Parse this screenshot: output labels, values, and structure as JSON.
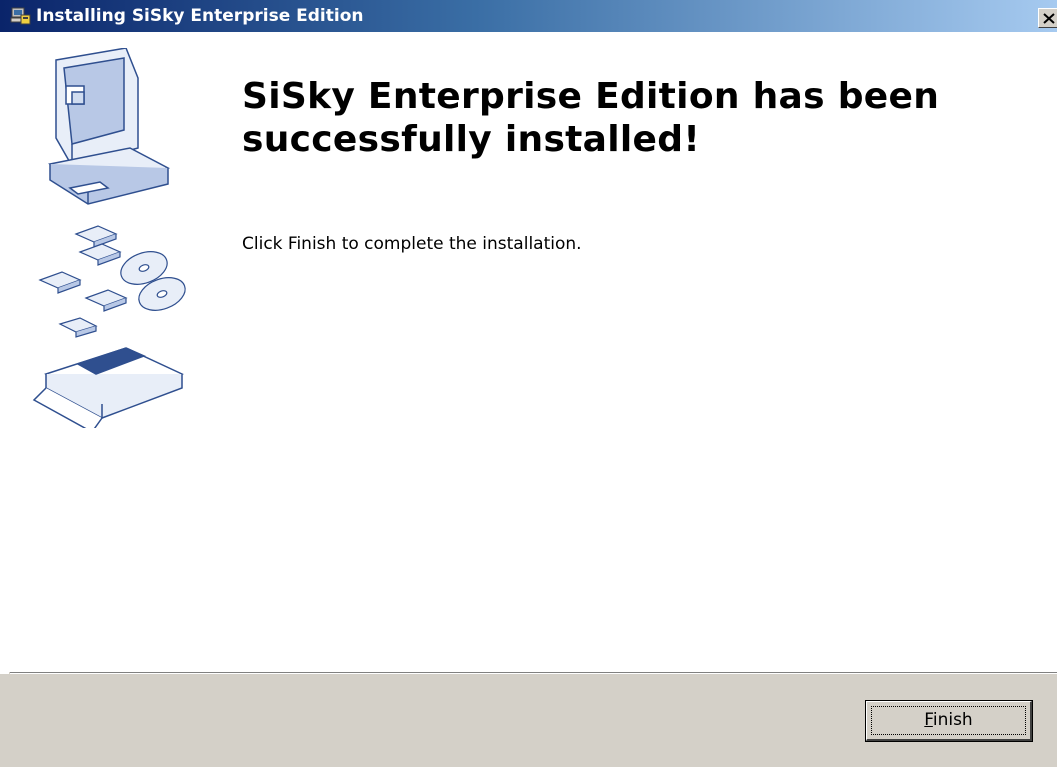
{
  "window": {
    "title": "Installing SiSky Enterprise Edition"
  },
  "content": {
    "heading": "SiSky Enterprise Edition has been successfully installed!",
    "subtext": "Click Finish to complete the installation."
  },
  "footer": {
    "finish_label_accel": "F",
    "finish_label_rest": "inish"
  },
  "icons": {
    "app": "installer-icon",
    "close": "close-icon",
    "illustration": "computer-disks-illustration"
  },
  "colors": {
    "titlebar_start": "#0a246a",
    "titlebar_end": "#a6caf0",
    "dialog_face": "#d4d0c8",
    "accent_blue": "#2f4f8f"
  }
}
